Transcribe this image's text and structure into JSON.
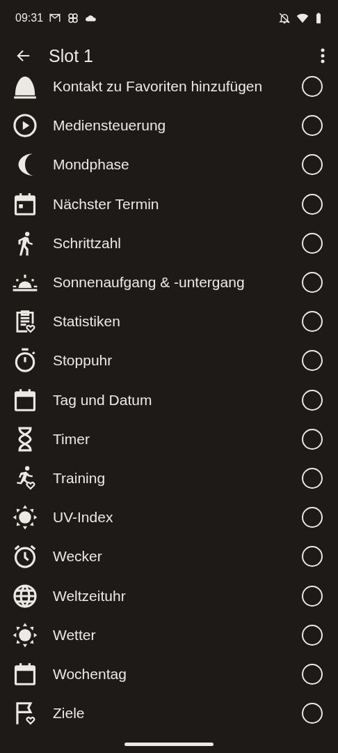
{
  "status_bar": {
    "time": "09:31"
  },
  "app_bar": {
    "title": "Slot 1"
  },
  "items": [
    {
      "label": "Kontakt zu Favoriten hinzufügen",
      "selected": false
    },
    {
      "label": "Mediensteuerung",
      "selected": false
    },
    {
      "label": "Mondphase",
      "selected": false
    },
    {
      "label": "Nächster Termin",
      "selected": false
    },
    {
      "label": "Schrittzahl",
      "selected": false
    },
    {
      "label": "Sonnenaufgang & -untergang",
      "selected": false
    },
    {
      "label": "Statistiken",
      "selected": false
    },
    {
      "label": "Stoppuhr",
      "selected": false
    },
    {
      "label": "Tag und Datum",
      "selected": false
    },
    {
      "label": "Timer",
      "selected": false
    },
    {
      "label": "Training",
      "selected": false
    },
    {
      "label": "UV-Index",
      "selected": false
    },
    {
      "label": "Wecker",
      "selected": false
    },
    {
      "label": "Weltzeituhr",
      "selected": false
    },
    {
      "label": "Wetter",
      "selected": false
    },
    {
      "label": "Wochentag",
      "selected": false
    },
    {
      "label": "Ziele",
      "selected": false
    }
  ]
}
